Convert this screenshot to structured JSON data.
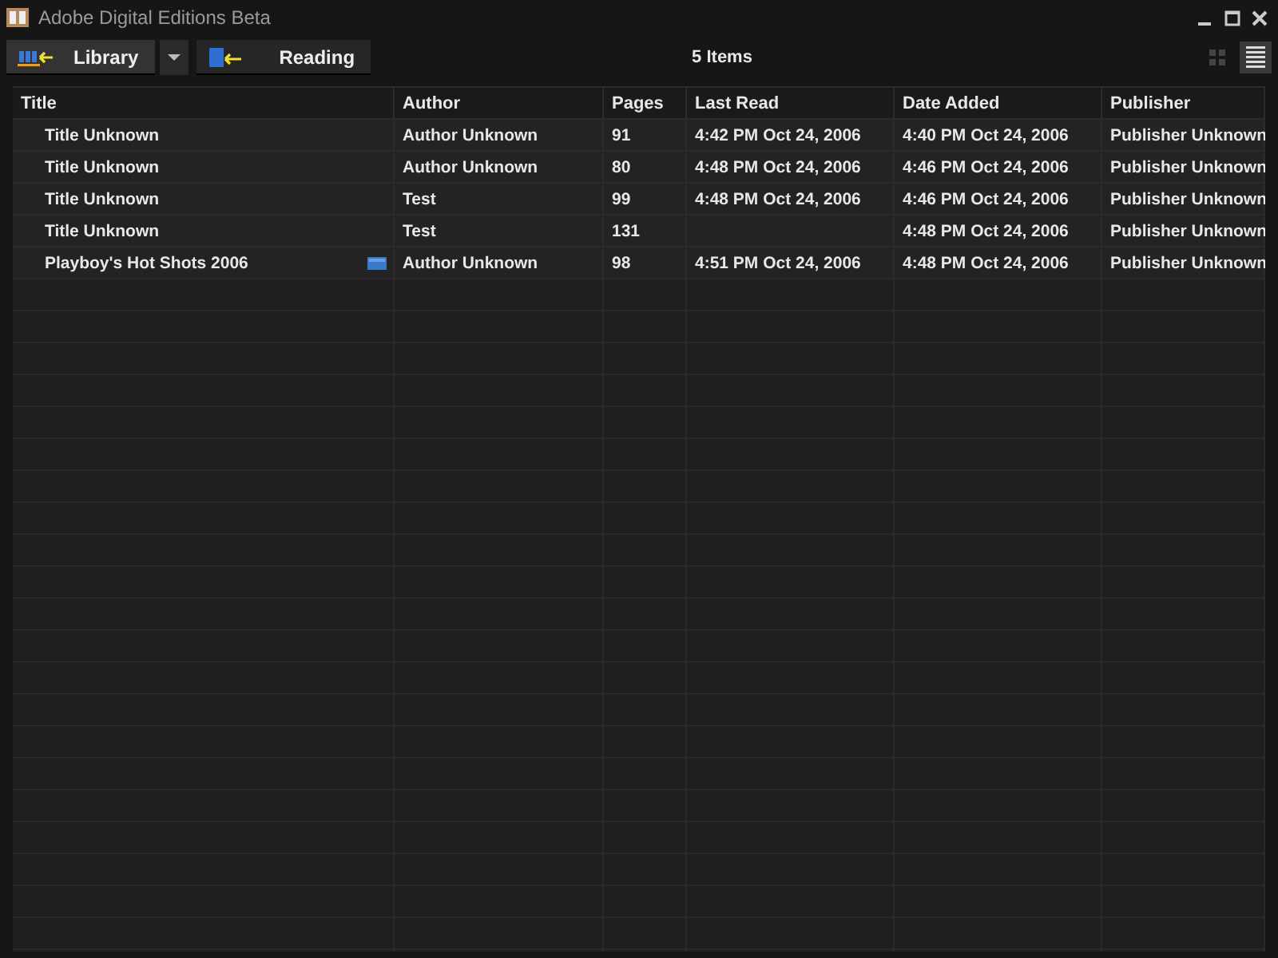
{
  "window": {
    "title": "Adobe Digital Editions Beta"
  },
  "toolbar": {
    "tabs": [
      {
        "label": "Library",
        "kind": "library",
        "selected": true
      },
      {
        "label": "Reading",
        "kind": "reading",
        "selected": false
      }
    ],
    "item_count": "5 Items",
    "views": [
      {
        "kind": "grid",
        "selected": false
      },
      {
        "kind": "list",
        "selected": true
      }
    ]
  },
  "table": {
    "columns": [
      "Title",
      "Author",
      "Pages",
      "Last Read",
      "Date Added",
      "Publisher"
    ],
    "rows": [
      {
        "title": "Title Unknown",
        "author": "Author Unknown",
        "pages": "91",
        "last_read": "4:42 PM Oct 24, 2006",
        "date_added": "4:40 PM Oct 24, 2006",
        "publisher": "Publisher Unknown",
        "has_badge": false
      },
      {
        "title": "Title Unknown",
        "author": "Author Unknown",
        "pages": "80",
        "last_read": "4:48 PM Oct 24, 2006",
        "date_added": "4:46 PM Oct 24, 2006",
        "publisher": "Publisher Unknown",
        "has_badge": false
      },
      {
        "title": "Title Unknown",
        "author": "Test",
        "pages": "99",
        "last_read": "4:48 PM Oct 24, 2006",
        "date_added": "4:46 PM Oct 24, 2006",
        "publisher": "Publisher Unknown",
        "has_badge": false
      },
      {
        "title": "Title Unknown",
        "author": "Test",
        "pages": "131",
        "date_added": "4:48 PM Oct 24, 2006",
        "publisher": "Publisher Unknown",
        "has_badge": false
      },
      {
        "title": "Playboy's Hot Shots 2006",
        "author": "Author Unknown",
        "pages": "98",
        "last_read": "4:51 PM Oct 24, 2006",
        "date_added": "4:48 PM Oct 24, 2006",
        "publisher": "Publisher Unknown",
        "has_badge": true
      }
    ]
  }
}
